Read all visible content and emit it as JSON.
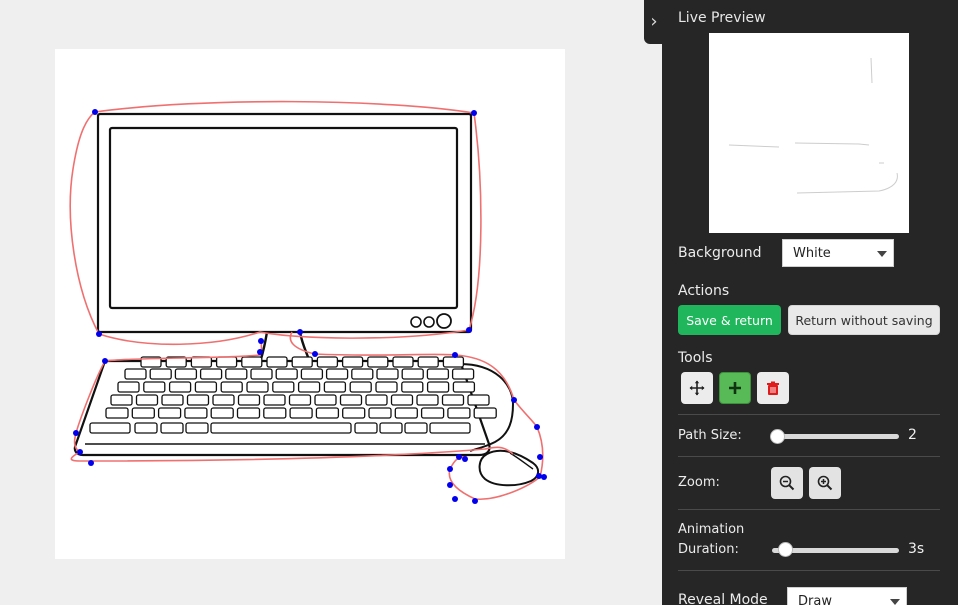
{
  "panel": {
    "title": "Live Preview",
    "collapse_icon": "chevron-right-icon",
    "background": {
      "label": "Background",
      "value": "White"
    },
    "actions": {
      "label": "Actions",
      "save_label": "Save & return",
      "discard_label": "Return without saving",
      "save_color": "#1fb65c"
    },
    "tools": {
      "label": "Tools",
      "items": [
        {
          "name": "move-icon",
          "active": false
        },
        {
          "name": "add-point-icon",
          "active": true
        },
        {
          "name": "delete-icon",
          "active": false
        }
      ]
    },
    "path_size": {
      "label": "Path Size:",
      "value": "2"
    },
    "zoom": {
      "label": "Zoom:",
      "buttons": [
        "zoom-out-icon",
        "zoom-in-icon"
      ]
    },
    "animation": {
      "label_line1": "Animation",
      "label_line2": "Duration:",
      "value": "3s"
    },
    "reveal_mode": {
      "label": "Reveal Mode",
      "value": "Draw"
    }
  },
  "canvas": {
    "image": "computer-illustration",
    "path_color": "#f07070",
    "point_color": "#0000ee"
  }
}
